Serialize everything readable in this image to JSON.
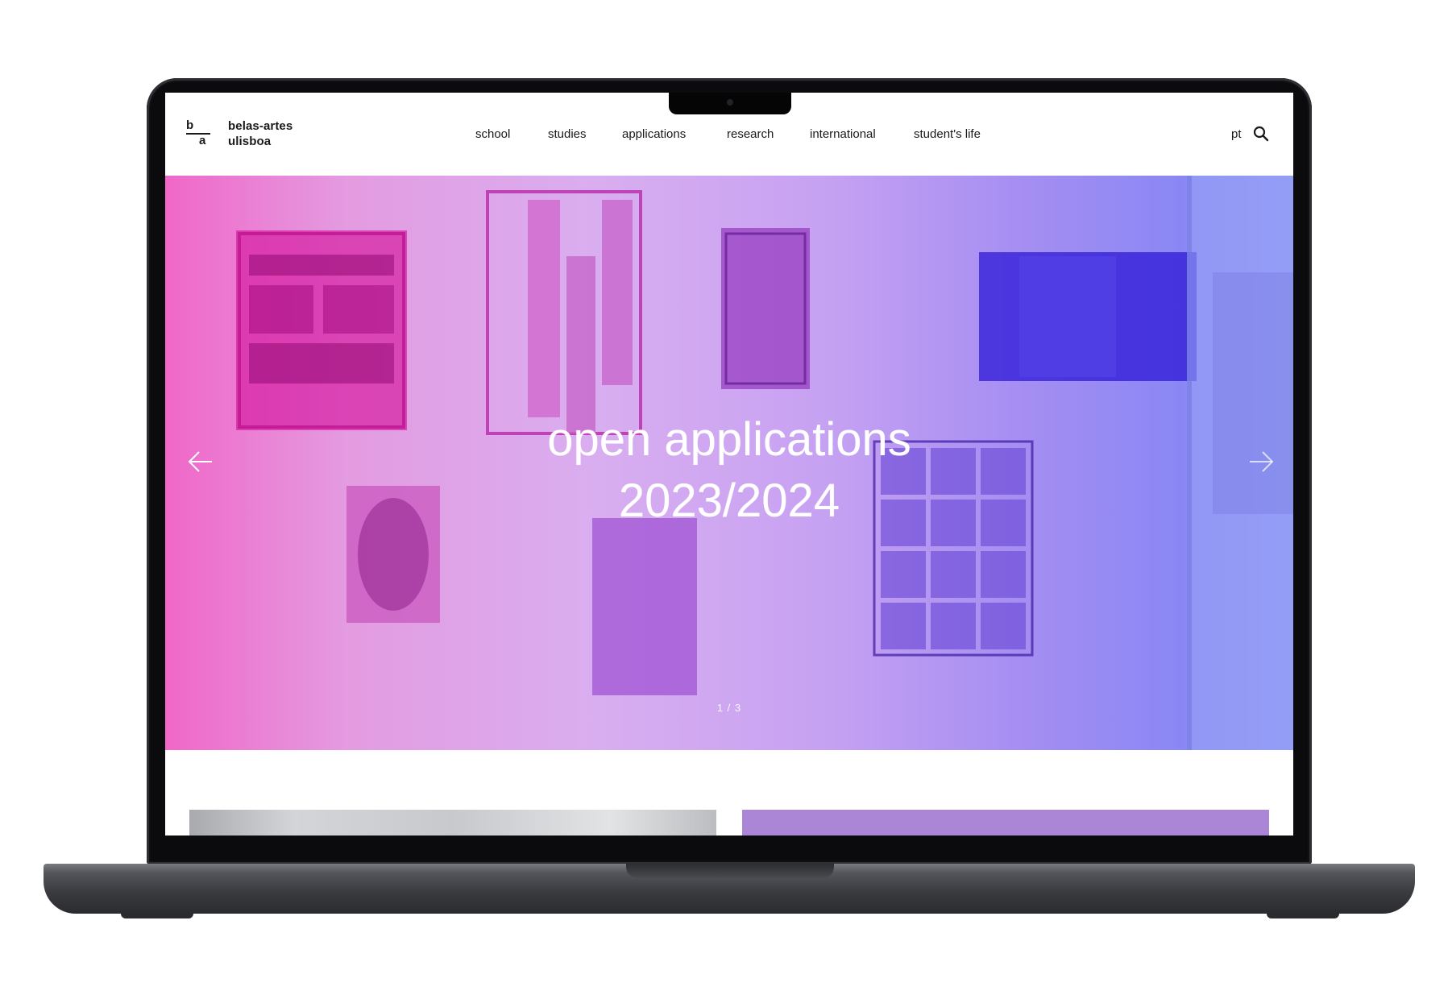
{
  "header": {
    "logo": {
      "top": "b",
      "bottom": "a"
    },
    "brand_line1": "belas-artes",
    "brand_line2": "ulisboa",
    "nav": [
      "school",
      "studies",
      "applications",
      "research",
      "international",
      "student's life"
    ],
    "lang": "pt",
    "search_icon": "search-icon"
  },
  "hero": {
    "title_line1": "open applications",
    "title_line2": "2023/2024",
    "counter": "1 / 3",
    "prev_icon": "arrow-left-icon",
    "next_icon": "arrow-right-icon"
  },
  "colors": {
    "gradient_start": "#f067c8",
    "gradient_mid": "#d9aef0",
    "gradient_end": "#8a87f4",
    "card_right": "#ab85d6"
  }
}
